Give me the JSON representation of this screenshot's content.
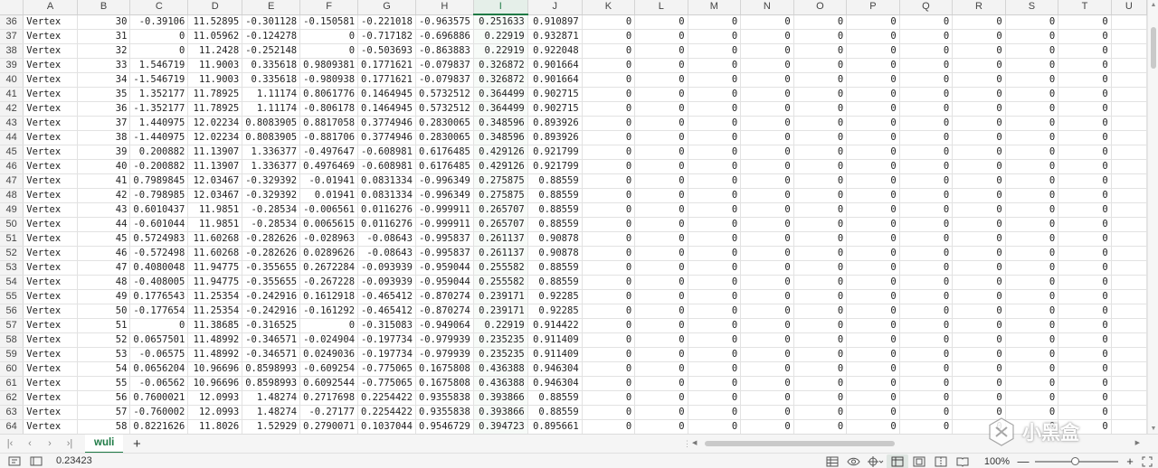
{
  "columns": [
    "A",
    "B",
    "C",
    "D",
    "E",
    "F",
    "G",
    "H",
    "I",
    "J",
    "K",
    "L",
    "M",
    "N",
    "O",
    "P",
    "Q",
    "R",
    "S",
    "T",
    "U"
  ],
  "selected_column": "I",
  "rows": [
    {
      "n": "36",
      "cells": [
        "Vertex",
        "30",
        "-0.39106",
        "11.52895",
        "-0.301128",
        "-0.150581",
        "-0.221018",
        "-0.963575",
        "0.251633",
        "0.910897",
        "0",
        "0",
        "0",
        "0",
        "0",
        "0",
        "0",
        "0",
        "0",
        "0"
      ]
    },
    {
      "n": "37",
      "cells": [
        "Vertex",
        "31",
        "0",
        "11.05962",
        "-0.124278",
        "0",
        "-0.717182",
        "-0.696886",
        "0.22919",
        "0.932871",
        "0",
        "0",
        "0",
        "0",
        "0",
        "0",
        "0",
        "0",
        "0",
        "0"
      ]
    },
    {
      "n": "38",
      "cells": [
        "Vertex",
        "32",
        "0",
        "11.2428",
        "-0.252148",
        "0",
        "-0.503693",
        "-0.863883",
        "0.22919",
        "0.922048",
        "0",
        "0",
        "0",
        "0",
        "0",
        "0",
        "0",
        "0",
        "0",
        "0"
      ]
    },
    {
      "n": "39",
      "cells": [
        "Vertex",
        "33",
        "1.546719",
        "11.9003",
        "0.335618",
        "0.9809381",
        "0.1771621",
        "-0.079837",
        "0.326872",
        "0.901664",
        "0",
        "0",
        "0",
        "0",
        "0",
        "0",
        "0",
        "0",
        "0",
        "0"
      ]
    },
    {
      "n": "40",
      "cells": [
        "Vertex",
        "34",
        "-1.546719",
        "11.9003",
        "0.335618",
        "-0.980938",
        "0.1771621",
        "-0.079837",
        "0.326872",
        "0.901664",
        "0",
        "0",
        "0",
        "0",
        "0",
        "0",
        "0",
        "0",
        "0",
        "0"
      ]
    },
    {
      "n": "41",
      "cells": [
        "Vertex",
        "35",
        "1.352177",
        "11.78925",
        "1.11174",
        "0.8061776",
        "0.1464945",
        "0.5732512",
        "0.364499",
        "0.902715",
        "0",
        "0",
        "0",
        "0",
        "0",
        "0",
        "0",
        "0",
        "0",
        "0"
      ]
    },
    {
      "n": "42",
      "cells": [
        "Vertex",
        "36",
        "-1.352177",
        "11.78925",
        "1.11174",
        "-0.806178",
        "0.1464945",
        "0.5732512",
        "0.364499",
        "0.902715",
        "0",
        "0",
        "0",
        "0",
        "0",
        "0",
        "0",
        "0",
        "0",
        "0"
      ]
    },
    {
      "n": "43",
      "cells": [
        "Vertex",
        "37",
        "1.440975",
        "12.02234",
        "0.8083905",
        "0.8817058",
        "0.3774946",
        "0.2830065",
        "0.348596",
        "0.893926",
        "0",
        "0",
        "0",
        "0",
        "0",
        "0",
        "0",
        "0",
        "0",
        "0"
      ]
    },
    {
      "n": "44",
      "cells": [
        "Vertex",
        "38",
        "-1.440975",
        "12.02234",
        "0.8083905",
        "-0.881706",
        "0.3774946",
        "0.2830065",
        "0.348596",
        "0.893926",
        "0",
        "0",
        "0",
        "0",
        "0",
        "0",
        "0",
        "0",
        "0",
        "0"
      ]
    },
    {
      "n": "45",
      "cells": [
        "Vertex",
        "39",
        "0.200882",
        "11.13907",
        "1.336377",
        "-0.497647",
        "-0.608981",
        "0.6176485",
        "0.429126",
        "0.921799",
        "0",
        "0",
        "0",
        "0",
        "0",
        "0",
        "0",
        "0",
        "0",
        "0"
      ]
    },
    {
      "n": "46",
      "cells": [
        "Vertex",
        "40",
        "-0.200882",
        "11.13907",
        "1.336377",
        "0.4976469",
        "-0.608981",
        "0.6176485",
        "0.429126",
        "0.921799",
        "0",
        "0",
        "0",
        "0",
        "0",
        "0",
        "0",
        "0",
        "0",
        "0"
      ]
    },
    {
      "n": "47",
      "cells": [
        "Vertex",
        "41",
        "0.7989845",
        "12.03467",
        "-0.329392",
        "-0.01941",
        "0.0831334",
        "-0.996349",
        "0.275875",
        "0.88559",
        "0",
        "0",
        "0",
        "0",
        "0",
        "0",
        "0",
        "0",
        "0",
        "0"
      ]
    },
    {
      "n": "48",
      "cells": [
        "Vertex",
        "42",
        "-0.798985",
        "12.03467",
        "-0.329392",
        "0.01941",
        "0.0831334",
        "-0.996349",
        "0.275875",
        "0.88559",
        "0",
        "0",
        "0",
        "0",
        "0",
        "0",
        "0",
        "0",
        "0",
        "0"
      ]
    },
    {
      "n": "49",
      "cells": [
        "Vertex",
        "43",
        "0.6010437",
        "11.9851",
        "-0.28534",
        "-0.006561",
        "0.0116276",
        "-0.999911",
        "0.265707",
        "0.88559",
        "0",
        "0",
        "0",
        "0",
        "0",
        "0",
        "0",
        "0",
        "0",
        "0"
      ]
    },
    {
      "n": "50",
      "cells": [
        "Vertex",
        "44",
        "-0.601044",
        "11.9851",
        "-0.28534",
        "0.0065615",
        "0.0116276",
        "-0.999911",
        "0.265707",
        "0.88559",
        "0",
        "0",
        "0",
        "0",
        "0",
        "0",
        "0",
        "0",
        "0",
        "0"
      ]
    },
    {
      "n": "51",
      "cells": [
        "Vertex",
        "45",
        "0.5724983",
        "11.60268",
        "-0.282626",
        "-0.028963",
        "-0.08643",
        "-0.995837",
        "0.261137",
        "0.90878",
        "0",
        "0",
        "0",
        "0",
        "0",
        "0",
        "0",
        "0",
        "0",
        "0"
      ]
    },
    {
      "n": "52",
      "cells": [
        "Vertex",
        "46",
        "-0.572498",
        "11.60268",
        "-0.282626",
        "0.0289626",
        "-0.08643",
        "-0.995837",
        "0.261137",
        "0.90878",
        "0",
        "0",
        "0",
        "0",
        "0",
        "0",
        "0",
        "0",
        "0",
        "0"
      ]
    },
    {
      "n": "53",
      "cells": [
        "Vertex",
        "47",
        "0.4080048",
        "11.94775",
        "-0.355655",
        "0.2672284",
        "-0.093939",
        "-0.959044",
        "0.255582",
        "0.88559",
        "0",
        "0",
        "0",
        "0",
        "0",
        "0",
        "0",
        "0",
        "0",
        "0"
      ]
    },
    {
      "n": "54",
      "cells": [
        "Vertex",
        "48",
        "-0.408005",
        "11.94775",
        "-0.355655",
        "-0.267228",
        "-0.093939",
        "-0.959044",
        "0.255582",
        "0.88559",
        "0",
        "0",
        "0",
        "0",
        "0",
        "0",
        "0",
        "0",
        "0",
        "0"
      ]
    },
    {
      "n": "55",
      "cells": [
        "Vertex",
        "49",
        "0.1776543",
        "11.25354",
        "-0.242916",
        "0.1612918",
        "-0.465412",
        "-0.870274",
        "0.239171",
        "0.92285",
        "0",
        "0",
        "0",
        "0",
        "0",
        "0",
        "0",
        "0",
        "0",
        "0"
      ]
    },
    {
      "n": "56",
      "cells": [
        "Vertex",
        "50",
        "-0.177654",
        "11.25354",
        "-0.242916",
        "-0.161292",
        "-0.465412",
        "-0.870274",
        "0.239171",
        "0.92285",
        "0",
        "0",
        "0",
        "0",
        "0",
        "0",
        "0",
        "0",
        "0",
        "0"
      ]
    },
    {
      "n": "57",
      "cells": [
        "Vertex",
        "51",
        "0",
        "11.38685",
        "-0.316525",
        "0",
        "-0.315083",
        "-0.949064",
        "0.22919",
        "0.914422",
        "0",
        "0",
        "0",
        "0",
        "0",
        "0",
        "0",
        "0",
        "0",
        "0"
      ]
    },
    {
      "n": "58",
      "cells": [
        "Vertex",
        "52",
        "0.0657501",
        "11.48992",
        "-0.346571",
        "-0.024904",
        "-0.197734",
        "-0.979939",
        "0.235235",
        "0.911409",
        "0",
        "0",
        "0",
        "0",
        "0",
        "0",
        "0",
        "0",
        "0",
        "0"
      ]
    },
    {
      "n": "59",
      "cells": [
        "Vertex",
        "53",
        "-0.06575",
        "11.48992",
        "-0.346571",
        "0.0249036",
        "-0.197734",
        "-0.979939",
        "0.235235",
        "0.911409",
        "0",
        "0",
        "0",
        "0",
        "0",
        "0",
        "0",
        "0",
        "0",
        "0"
      ]
    },
    {
      "n": "60",
      "cells": [
        "Vertex",
        "54",
        "0.0656204",
        "10.96696",
        "0.8598993",
        "-0.609254",
        "-0.775065",
        "0.1675808",
        "0.436388",
        "0.946304",
        "0",
        "0",
        "0",
        "0",
        "0",
        "0",
        "0",
        "0",
        "0",
        "0"
      ]
    },
    {
      "n": "61",
      "cells": [
        "Vertex",
        "55",
        "-0.06562",
        "10.96696",
        "0.8598993",
        "0.6092544",
        "-0.775065",
        "0.1675808",
        "0.436388",
        "0.946304",
        "0",
        "0",
        "0",
        "0",
        "0",
        "0",
        "0",
        "0",
        "0",
        "0"
      ]
    },
    {
      "n": "62",
      "cells": [
        "Vertex",
        "56",
        "0.7600021",
        "12.0993",
        "1.48274",
        "0.2717698",
        "0.2254422",
        "0.9355838",
        "0.393866",
        "0.88559",
        "0",
        "0",
        "0",
        "0",
        "0",
        "0",
        "0",
        "0",
        "0",
        "0"
      ]
    },
    {
      "n": "63",
      "cells": [
        "Vertex",
        "57",
        "-0.760002",
        "12.0993",
        "1.48274",
        "-0.27177",
        "0.2254422",
        "0.9355838",
        "0.393866",
        "0.88559",
        "0",
        "0",
        "0",
        "0",
        "0",
        "0",
        "0",
        "0",
        "0",
        "0"
      ]
    },
    {
      "n": "64",
      "cells": [
        "Vertex",
        "58",
        "0.8221626",
        "11.8026",
        "1.52929",
        "0.2790071",
        "0.1037044",
        "0.9546729",
        "0.394723",
        "0.895661",
        "0",
        "0",
        "0",
        "0",
        "0",
        "0",
        "0",
        "0",
        "0",
        "0"
      ]
    }
  ],
  "sheet_tab": "wuli",
  "add_sheet_label": "+",
  "status": {
    "cell_value": "0.23423",
    "zoom": "100%",
    "zoom_out": "—",
    "zoom_in": "+"
  },
  "watermark": {
    "text": "小黑盒"
  },
  "colors": {
    "accent": "#1e7a45",
    "header_bg": "#f3f3f3",
    "grid_line": "#e2e2e2"
  }
}
